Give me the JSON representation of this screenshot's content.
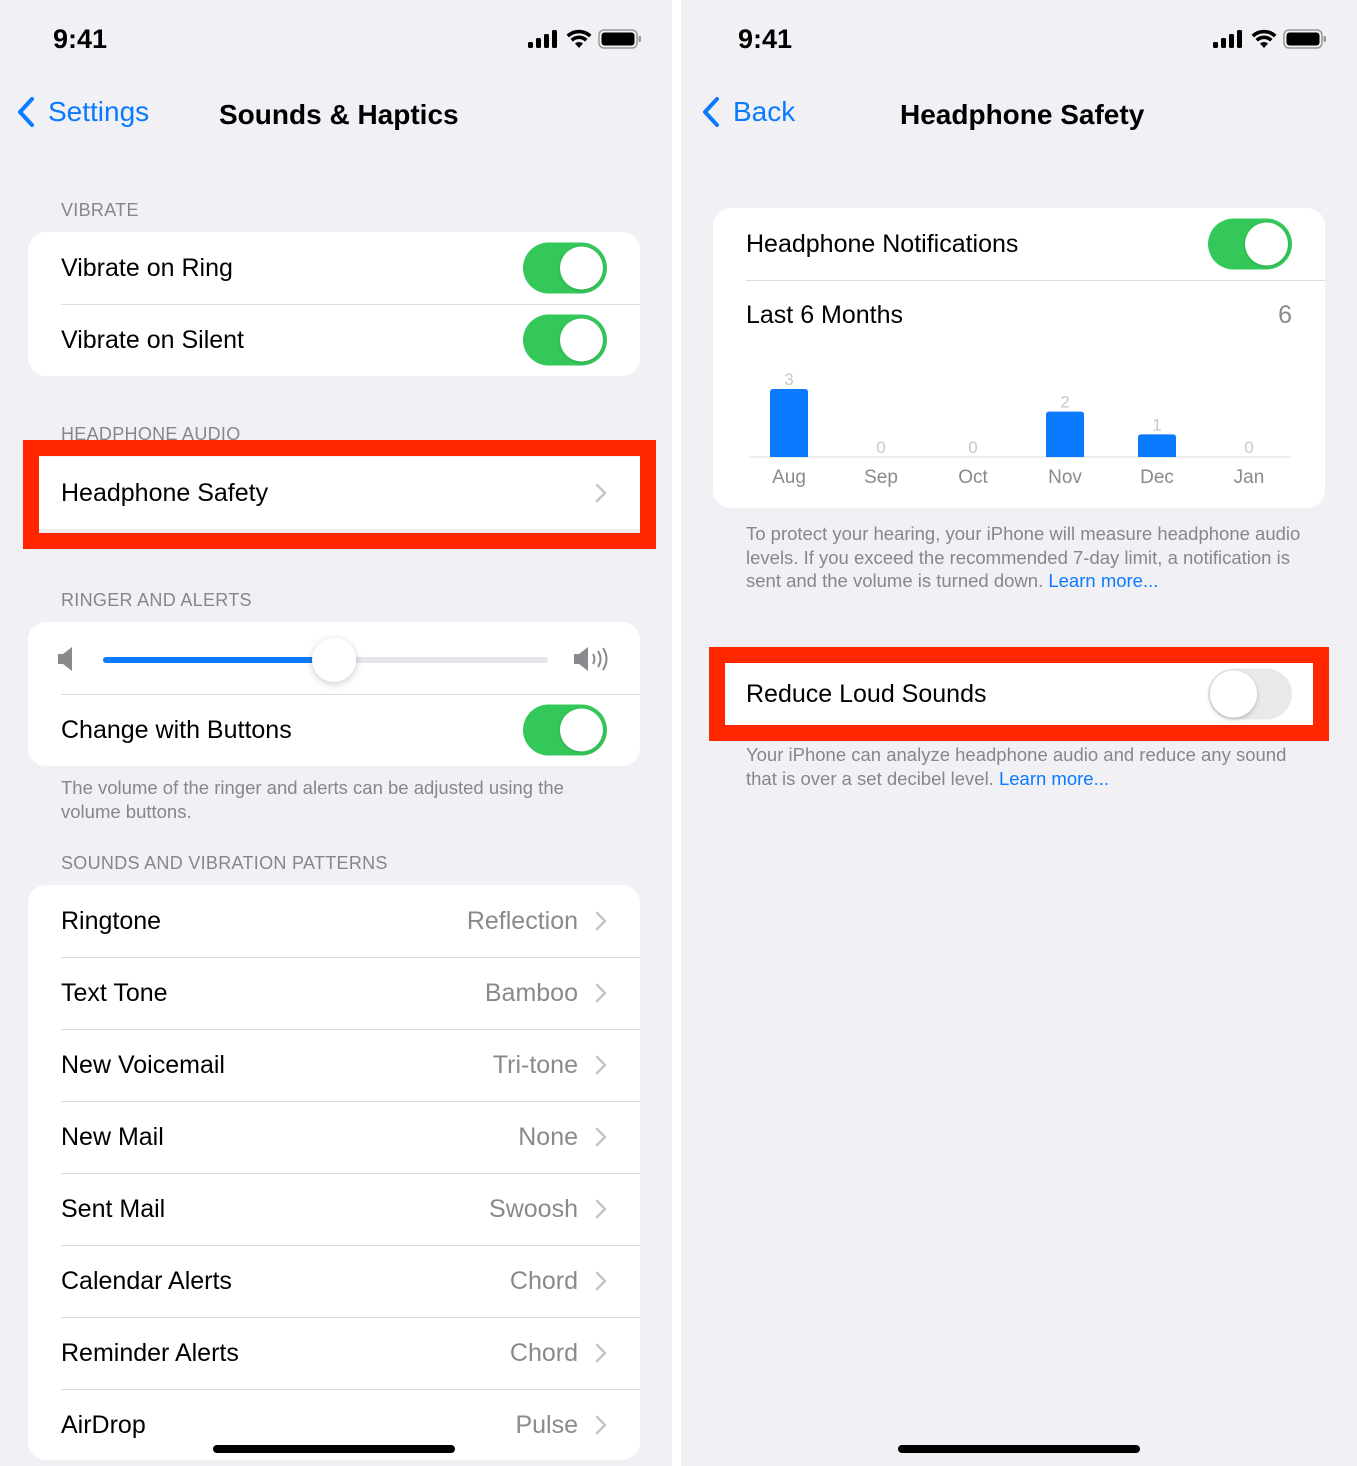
{
  "left_screen": {
    "status_bar": {
      "time": "9:41",
      "icons": [
        "cellular-signal-icon",
        "wifi-icon",
        "battery-icon"
      ]
    },
    "nav": {
      "back_label": "Settings",
      "title": "Sounds & Haptics"
    },
    "vibrate": {
      "header": "VIBRATE",
      "rows": [
        {
          "label": "Vibrate on Ring",
          "on": true
        },
        {
          "label": "Vibrate on Silent",
          "on": true
        }
      ]
    },
    "headphone_audio": {
      "header": "HEADPHONE AUDIO",
      "row_label": "Headphone Safety"
    },
    "ringer": {
      "header": "RINGER AND ALERTS",
      "volume_level": 0.52,
      "change_with_buttons_label": "Change with Buttons",
      "change_with_buttons_on": true,
      "footer": "The volume of the ringer and alerts can be adjusted using the volume buttons."
    },
    "sounds": {
      "header": "SOUNDS AND VIBRATION PATTERNS",
      "rows": [
        {
          "label": "Ringtone",
          "value": "Reflection"
        },
        {
          "label": "Text Tone",
          "value": "Bamboo"
        },
        {
          "label": "New Voicemail",
          "value": "Tri-tone"
        },
        {
          "label": "New Mail",
          "value": "None"
        },
        {
          "label": "Sent Mail",
          "value": "Swoosh"
        },
        {
          "label": "Calendar Alerts",
          "value": "Chord"
        },
        {
          "label": "Reminder Alerts",
          "value": "Chord"
        },
        {
          "label": "AirDrop",
          "value": "Pulse"
        }
      ]
    }
  },
  "right_screen": {
    "status_bar": {
      "time": "9:41",
      "icons": [
        "cellular-signal-icon",
        "wifi-icon",
        "battery-icon"
      ]
    },
    "nav": {
      "back_label": "Back",
      "title": "Headphone Safety"
    },
    "notifications": {
      "label": "Headphone Notifications",
      "on": true,
      "period_label": "Last 6 Months",
      "period_total": "6"
    },
    "footer": {
      "text": "To protect your hearing, your iPhone will measure headphone audio levels. If you exceed the recommended 7-day limit, a notification is sent and the volume is turned down. ",
      "link": "Learn more..."
    },
    "reduce_loud": {
      "label": "Reduce Loud Sounds",
      "on": false,
      "footer_text": "Your iPhone can analyze headphone audio and reduce any sound that is over a set decibel level. ",
      "footer_link": "Learn more..."
    }
  },
  "annotations": {
    "highlight_color": "#ff2600",
    "highlighted_items": [
      "Headphone Safety",
      "Reduce Loud Sounds"
    ]
  },
  "colors": {
    "accent": "#0a7aff",
    "toggle_on": "#34c759",
    "background": "#f1f0f5",
    "bar": "#0a7aff"
  },
  "chart_data": {
    "type": "bar",
    "title": "Last 6 Months",
    "categories": [
      "Aug",
      "Sep",
      "Oct",
      "Nov",
      "Dec",
      "Jan"
    ],
    "values": [
      3,
      0,
      0,
      2,
      1,
      0
    ],
    "xlabel": "",
    "ylabel": "",
    "ylim": [
      0,
      3
    ],
    "grid": false,
    "data_labels": true
  }
}
